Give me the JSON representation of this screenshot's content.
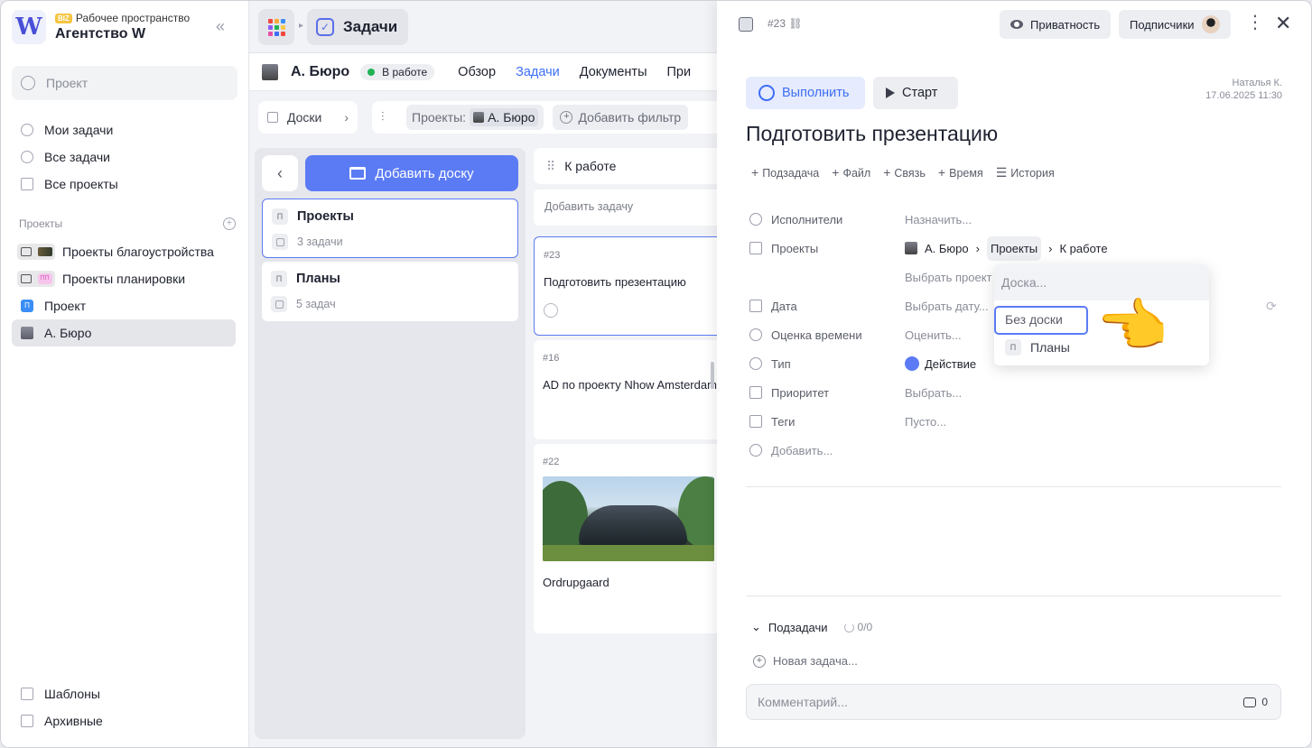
{
  "sidebar": {
    "workspace_badge": "BIZ",
    "workspace_label": "Рабочее пространство",
    "workspace_name": "Агентство W",
    "logo_letter": "W",
    "search_placeholder": "Проект",
    "nav": [
      "Мои задачи",
      "Все задачи",
      "Все проекты"
    ],
    "projects_heading": "Проекты",
    "projects": [
      {
        "label": "Проекты благоустройства",
        "icon": "folder-photo"
      },
      {
        "label": "Проекты планировки",
        "icon": "folder-pp",
        "badge": "ПП"
      },
      {
        "label": "Проект",
        "icon": "blue-square",
        "badge": "П"
      },
      {
        "label": "А. Бюро",
        "icon": "building",
        "active": true
      }
    ],
    "bottom": [
      "Шаблоны",
      "Архивные"
    ]
  },
  "topbar": {
    "tab_title": "Задачи",
    "app_grid_colors": [
      "#f0493e",
      "#f7a93b",
      "#3b8ef5",
      "#8b5cf6",
      "#21b256",
      "#f7c948",
      "#e64fa7",
      "#3d6ef5",
      "#f0493e"
    ]
  },
  "project_header": {
    "title": "А. Бюро",
    "status": "В работе",
    "status_color": "#21b256",
    "tabs": [
      "Обзор",
      "Задачи",
      "Документы",
      "При"
    ],
    "active_tab": "Задачи"
  },
  "filters": {
    "boards_label": "Доски",
    "projects_label": "Проекты:",
    "project_chip": "А. Бюро",
    "add_filter": "Добавить фильтр"
  },
  "boards": {
    "add_board": "Добавить доску",
    "items": [
      {
        "badge": "П",
        "name": "Проекты",
        "count": "3 задачи",
        "selected": true
      },
      {
        "badge": "П",
        "name": "Планы",
        "count": "5 задач",
        "selected": false
      }
    ]
  },
  "column": {
    "title": "К работе",
    "add_task": "Добавить задачу",
    "cards": [
      {
        "num": "#23",
        "title": "Подготовить презентацию"
      },
      {
        "num": "#16",
        "title": "AD по проекту Nhow Amsterdam"
      },
      {
        "num": "#22",
        "title": "Ordrupgaard"
      }
    ]
  },
  "panel": {
    "task_id": "#23",
    "privacy": "Приватность",
    "subscribers": "Подписчики",
    "done_btn": "Выполнить",
    "start_btn": "Старт",
    "author": "Наталья К.",
    "date": "17.06.2025 11:30",
    "title": "Подготовить презентацию",
    "quick": [
      "Подзадача",
      "Файл",
      "Связь",
      "Время",
      "История"
    ],
    "props": {
      "assignees_label": "Исполнители",
      "assignees_value": "Назначить...",
      "projects_label": "Проекты",
      "proj_root": "А. Бюро",
      "proj_board": "Проекты",
      "proj_column": "К работе",
      "choose_project": "Выбрать проект",
      "date_label": "Дата",
      "date_value": "Выбрать дату...",
      "estimate_label": "Оценка времени",
      "estimate_value": "Оценить...",
      "type_label": "Тип",
      "type_value": "Действие",
      "priority_label": "Приоритет",
      "priority_value": "Выбрать...",
      "tags_label": "Теги",
      "tags_value": "Пусто...",
      "add_label": "Добавить..."
    },
    "dropdown": {
      "placeholder": "Доска...",
      "option_none": "Без доски",
      "option_badge": "П",
      "option_plans": "Планы"
    },
    "pointer_emoji": "👈",
    "subtasks_label": "Подзадачи",
    "subtasks_count": "0/0",
    "new_task": "Новая задача...",
    "comment_placeholder": "Комментарий...",
    "comment_count": "0"
  }
}
